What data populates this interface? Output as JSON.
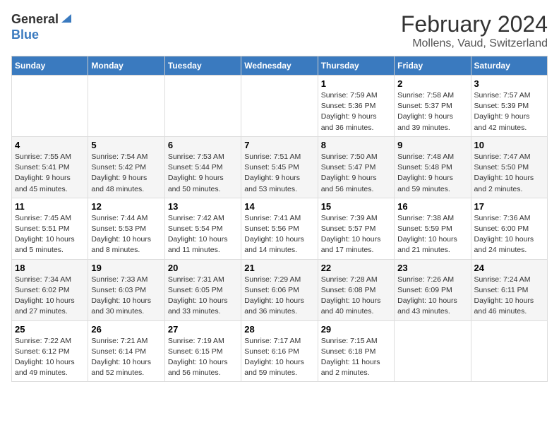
{
  "header": {
    "logo_general": "General",
    "logo_blue": "Blue",
    "month_year": "February 2024",
    "location": "Mollens, Vaud, Switzerland"
  },
  "days_of_week": [
    "Sunday",
    "Monday",
    "Tuesday",
    "Wednesday",
    "Thursday",
    "Friday",
    "Saturday"
  ],
  "weeks": [
    [
      {
        "day": "",
        "detail": ""
      },
      {
        "day": "",
        "detail": ""
      },
      {
        "day": "",
        "detail": ""
      },
      {
        "day": "",
        "detail": ""
      },
      {
        "day": "1",
        "detail": "Sunrise: 7:59 AM\nSunset: 5:36 PM\nDaylight: 9 hours\nand 36 minutes."
      },
      {
        "day": "2",
        "detail": "Sunrise: 7:58 AM\nSunset: 5:37 PM\nDaylight: 9 hours\nand 39 minutes."
      },
      {
        "day": "3",
        "detail": "Sunrise: 7:57 AM\nSunset: 5:39 PM\nDaylight: 9 hours\nand 42 minutes."
      }
    ],
    [
      {
        "day": "4",
        "detail": "Sunrise: 7:55 AM\nSunset: 5:41 PM\nDaylight: 9 hours\nand 45 minutes."
      },
      {
        "day": "5",
        "detail": "Sunrise: 7:54 AM\nSunset: 5:42 PM\nDaylight: 9 hours\nand 48 minutes."
      },
      {
        "day": "6",
        "detail": "Sunrise: 7:53 AM\nSunset: 5:44 PM\nDaylight: 9 hours\nand 50 minutes."
      },
      {
        "day": "7",
        "detail": "Sunrise: 7:51 AM\nSunset: 5:45 PM\nDaylight: 9 hours\nand 53 minutes."
      },
      {
        "day": "8",
        "detail": "Sunrise: 7:50 AM\nSunset: 5:47 PM\nDaylight: 9 hours\nand 56 minutes."
      },
      {
        "day": "9",
        "detail": "Sunrise: 7:48 AM\nSunset: 5:48 PM\nDaylight: 9 hours\nand 59 minutes."
      },
      {
        "day": "10",
        "detail": "Sunrise: 7:47 AM\nSunset: 5:50 PM\nDaylight: 10 hours\nand 2 minutes."
      }
    ],
    [
      {
        "day": "11",
        "detail": "Sunrise: 7:45 AM\nSunset: 5:51 PM\nDaylight: 10 hours\nand 5 minutes."
      },
      {
        "day": "12",
        "detail": "Sunrise: 7:44 AM\nSunset: 5:53 PM\nDaylight: 10 hours\nand 8 minutes."
      },
      {
        "day": "13",
        "detail": "Sunrise: 7:42 AM\nSunset: 5:54 PM\nDaylight: 10 hours\nand 11 minutes."
      },
      {
        "day": "14",
        "detail": "Sunrise: 7:41 AM\nSunset: 5:56 PM\nDaylight: 10 hours\nand 14 minutes."
      },
      {
        "day": "15",
        "detail": "Sunrise: 7:39 AM\nSunset: 5:57 PM\nDaylight: 10 hours\nand 17 minutes."
      },
      {
        "day": "16",
        "detail": "Sunrise: 7:38 AM\nSunset: 5:59 PM\nDaylight: 10 hours\nand 21 minutes."
      },
      {
        "day": "17",
        "detail": "Sunrise: 7:36 AM\nSunset: 6:00 PM\nDaylight: 10 hours\nand 24 minutes."
      }
    ],
    [
      {
        "day": "18",
        "detail": "Sunrise: 7:34 AM\nSunset: 6:02 PM\nDaylight: 10 hours\nand 27 minutes."
      },
      {
        "day": "19",
        "detail": "Sunrise: 7:33 AM\nSunset: 6:03 PM\nDaylight: 10 hours\nand 30 minutes."
      },
      {
        "day": "20",
        "detail": "Sunrise: 7:31 AM\nSunset: 6:05 PM\nDaylight: 10 hours\nand 33 minutes."
      },
      {
        "day": "21",
        "detail": "Sunrise: 7:29 AM\nSunset: 6:06 PM\nDaylight: 10 hours\nand 36 minutes."
      },
      {
        "day": "22",
        "detail": "Sunrise: 7:28 AM\nSunset: 6:08 PM\nDaylight: 10 hours\nand 40 minutes."
      },
      {
        "day": "23",
        "detail": "Sunrise: 7:26 AM\nSunset: 6:09 PM\nDaylight: 10 hours\nand 43 minutes."
      },
      {
        "day": "24",
        "detail": "Sunrise: 7:24 AM\nSunset: 6:11 PM\nDaylight: 10 hours\nand 46 minutes."
      }
    ],
    [
      {
        "day": "25",
        "detail": "Sunrise: 7:22 AM\nSunset: 6:12 PM\nDaylight: 10 hours\nand 49 minutes."
      },
      {
        "day": "26",
        "detail": "Sunrise: 7:21 AM\nSunset: 6:14 PM\nDaylight: 10 hours\nand 52 minutes."
      },
      {
        "day": "27",
        "detail": "Sunrise: 7:19 AM\nSunset: 6:15 PM\nDaylight: 10 hours\nand 56 minutes."
      },
      {
        "day": "28",
        "detail": "Sunrise: 7:17 AM\nSunset: 6:16 PM\nDaylight: 10 hours\nand 59 minutes."
      },
      {
        "day": "29",
        "detail": "Sunrise: 7:15 AM\nSunset: 6:18 PM\nDaylight: 11 hours\nand 2 minutes."
      },
      {
        "day": "",
        "detail": ""
      },
      {
        "day": "",
        "detail": ""
      }
    ]
  ]
}
